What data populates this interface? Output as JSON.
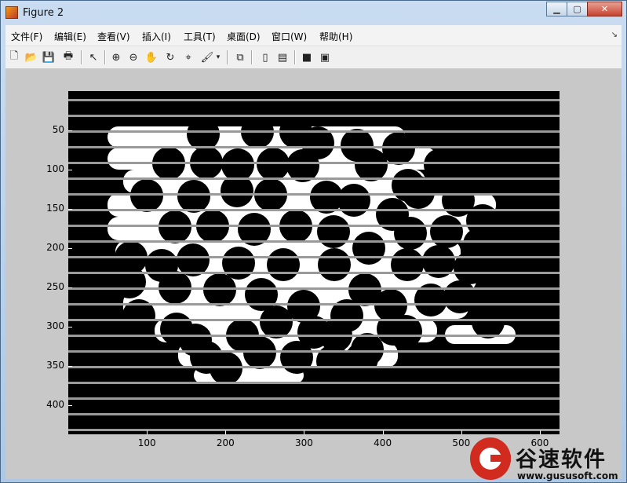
{
  "window": {
    "title": "Figure 2"
  },
  "menu": [
    "文件(F)",
    "编辑(E)",
    "查看(V)",
    "插入(I)",
    "工具(T)",
    "桌面(D)",
    "窗口(W)",
    "帮助(H)"
  ],
  "toolbar_icons": [
    "new-figure-icon",
    "open-file-icon",
    "save-icon",
    "print-icon",
    "edit-plot-icon",
    "zoom-in-icon",
    "zoom-out-icon",
    "pan-icon",
    "rotate-3d-icon",
    "data-cursor-icon",
    "brush-icon",
    "link-plot-icon",
    "colorbar-icon",
    "legend-icon",
    "hide-plot-tools-icon",
    "show-plot-tools-icon"
  ],
  "axes": {
    "y_ticks": [
      "50",
      "100",
      "150",
      "200",
      "250",
      "300",
      "350",
      "400"
    ],
    "x_ticks": [
      "100",
      "200",
      "300",
      "400",
      "500",
      "600"
    ],
    "y_values": [
      50,
      100,
      150,
      200,
      250,
      300,
      350,
      400
    ],
    "x_values": [
      100,
      200,
      300,
      400,
      500,
      600
    ],
    "x_range": [
      0,
      625
    ],
    "y_range": [
      0,
      437
    ]
  },
  "watermark": {
    "cn": "谷速软件",
    "url": "www.gususoft.com"
  }
}
